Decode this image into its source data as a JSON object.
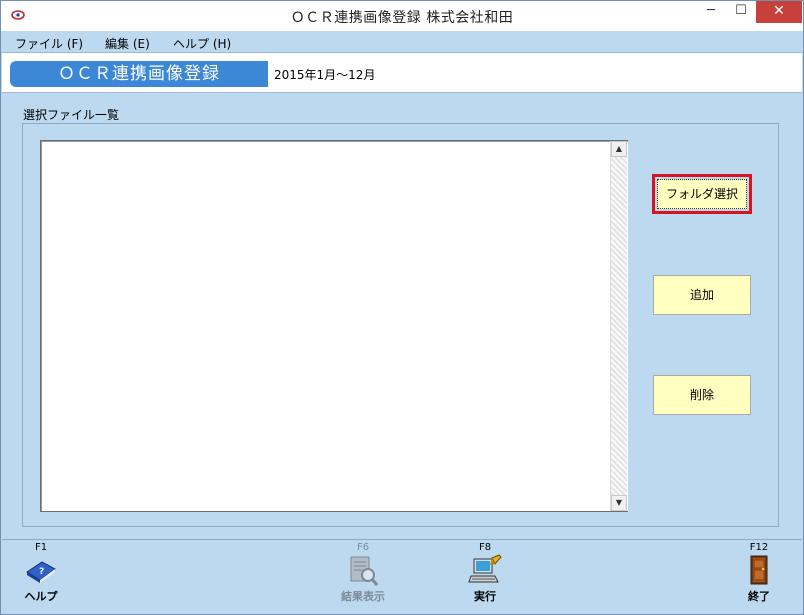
{
  "window": {
    "title": "ＯＣＲ連携画像登録 株式会社和田",
    "minimize_glyph": "─",
    "maximize_glyph": "☐",
    "close_glyph": "✕"
  },
  "menu": {
    "file": "ファイル (F)",
    "edit": "編集 (E)",
    "help": "ヘルプ (H)"
  },
  "header": {
    "title": "ＯＣＲ連携画像登録",
    "period": "2015年1月～12月"
  },
  "file_list": {
    "group_label": "選択ファイル一覧",
    "items": []
  },
  "buttons": {
    "folder_select": "フォルダ選択",
    "add": "追加",
    "delete": "削除"
  },
  "function_keys": {
    "help": {
      "key": "F1",
      "label": "ヘルプ",
      "icon": "help-book-icon",
      "enabled": true
    },
    "result": {
      "key": "F6",
      "label": "結果表示",
      "icon": "result-magnifier-icon",
      "enabled": false
    },
    "run": {
      "key": "F8",
      "label": "実行",
      "icon": "run-computer-icon",
      "enabled": true
    },
    "end": {
      "key": "F12",
      "label": "終了",
      "icon": "exit-door-icon",
      "enabled": true
    }
  },
  "colors": {
    "header_title_bg": "#3c88d6",
    "button_bg": "#ffffc0",
    "focus_border": "#d9141e",
    "window_bg": "#bcd9f0",
    "close_button": "#c7413a"
  }
}
